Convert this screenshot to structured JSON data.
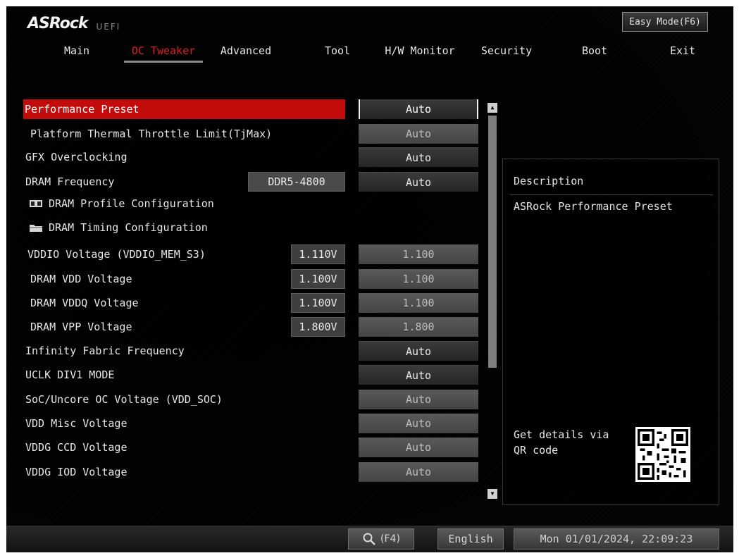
{
  "header": {
    "brand": "ASRock",
    "sub": "UEFI",
    "easy_mode": "Easy Mode(F6)"
  },
  "nav": [
    {
      "label": "Main",
      "active": false
    },
    {
      "label": "OC Tweaker",
      "active": true
    },
    {
      "label": "Advanced",
      "active": false
    },
    {
      "label": "Tool",
      "active": false
    },
    {
      "label": "H/W Monitor",
      "active": false
    },
    {
      "label": "Security",
      "active": false
    },
    {
      "label": "Boot",
      "active": false
    },
    {
      "label": "Exit",
      "active": false
    }
  ],
  "settings": [
    {
      "label": "Performance Preset",
      "value": "Auto",
      "state": "selected"
    },
    {
      "label": "Platform Thermal Throttle Limit(TjMax)",
      "value": "Auto",
      "state": "dim"
    },
    {
      "label": "GFX Overclocking",
      "value": "Auto",
      "state": "active"
    },
    {
      "label": "DRAM Frequency",
      "info": "DDR5-4800",
      "value": "Auto",
      "state": "active"
    },
    {
      "label": "DRAM Profile Configuration",
      "icon": "memory-icon"
    },
    {
      "label": "DRAM Timing Configuration",
      "icon": "folder-icon"
    },
    {
      "label": "VDDIO Voltage (VDDIO_MEM_S3)",
      "info": "1.110V",
      "value": "1.100",
      "state": "dim"
    },
    {
      "label": "DRAM VDD Voltage",
      "info": "1.100V",
      "value": "1.100",
      "state": "dim"
    },
    {
      "label": "DRAM VDDQ Voltage",
      "info": "1.100V",
      "value": "1.100",
      "state": "dim"
    },
    {
      "label": "DRAM VPP Voltage",
      "info": "1.800V",
      "value": "1.800",
      "state": "dim"
    },
    {
      "label": "Infinity Fabric Frequency",
      "value": "Auto",
      "state": "active"
    },
    {
      "label": "UCLK DIV1 MODE",
      "value": "Auto",
      "state": "active"
    },
    {
      "label": "SoC/Uncore OC Voltage (VDD_SOC)",
      "value": "Auto",
      "state": "dim"
    },
    {
      "label": "VDD Misc Voltage",
      "value": "Auto",
      "state": "dim"
    },
    {
      "label": "VDDG CCD Voltage",
      "value": "Auto",
      "state": "dim"
    },
    {
      "label": "VDDG IOD Voltage",
      "value": "Auto",
      "state": "dim"
    }
  ],
  "description": {
    "title": "Description",
    "text": "ASRock Performance Preset",
    "qr_text": "Get details via QR code"
  },
  "footer": {
    "search_key": "(F4)",
    "language": "English",
    "datetime": "Mon 01/01/2024, 22:09:23"
  },
  "colors": {
    "accent": "#c20c0c",
    "active_tab": "#e21d1d"
  }
}
